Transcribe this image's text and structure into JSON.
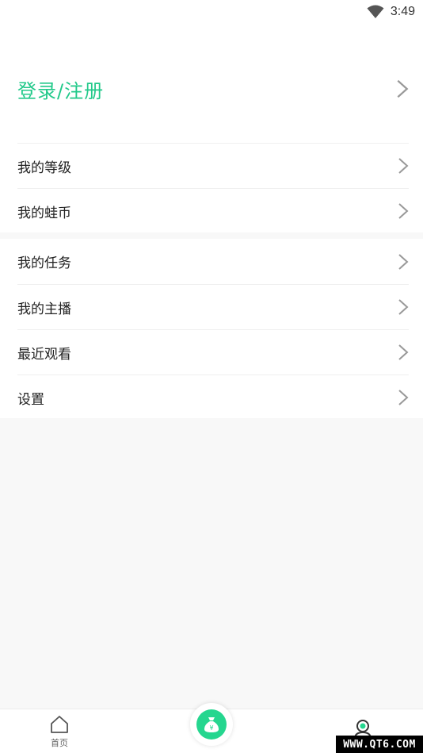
{
  "status_bar": {
    "time": "3:49",
    "wifi_icon": "wifi-icon"
  },
  "header": {
    "login_label": "登录/注册"
  },
  "menu_group_1": [
    {
      "label": "我的等级"
    },
    {
      "label": "我的蛙币"
    }
  ],
  "menu_group_2": [
    {
      "label": "我的任务"
    },
    {
      "label": "我的主播"
    },
    {
      "label": "最近观看"
    },
    {
      "label": "设置"
    }
  ],
  "tabbar": {
    "home_label": "首页",
    "center_icon": "money-bag-icon",
    "mine_icon": "profile-icon"
  },
  "watermark": "WWW.QT6.COM",
  "colors": {
    "accent": "#22c98a",
    "background": "#f8f8f8",
    "chevron": "#999999"
  }
}
